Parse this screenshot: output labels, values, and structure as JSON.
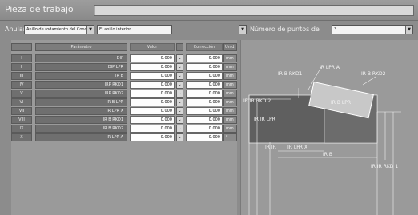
{
  "header": {
    "title": "Pieza de trabajo",
    "field_value": ""
  },
  "selectors": {
    "apply_label": "Anular",
    "ring_combo_value": "Anillo de rodamiento del Cono",
    "type_combo_value": "El anillo interior",
    "points_label": "Número de puntos de",
    "points_combo_value": "3",
    "arrow_glyph": "▼"
  },
  "table": {
    "header": {
      "index": "",
      "name": "Parámetro",
      "value": "Valor",
      "button": "",
      "correction": "Corrección",
      "unit": "Unid."
    },
    "rows": [
      {
        "index": "I",
        "name": "DIP",
        "value": "0.000",
        "button": "⌄",
        "correction": "0.000",
        "unit": "mm"
      },
      {
        "index": "II",
        "name": "DIP LPR",
        "value": "0.000",
        "button": "⌄",
        "correction": "0.000",
        "unit": "mm"
      },
      {
        "index": "III",
        "name": "IR B",
        "value": "0.000",
        "button": "⌄",
        "correction": "0.000",
        "unit": "mm"
      },
      {
        "index": "IV",
        "name": "IRP RKD1",
        "value": "0.000",
        "button": "⌄",
        "correction": "0.000",
        "unit": "mm"
      },
      {
        "index": "V",
        "name": "IRP RKD2",
        "value": "0.000",
        "button": "⌄",
        "correction": "0.000",
        "unit": "mm"
      },
      {
        "index": "VI",
        "name": "IR B LPR",
        "value": "0.000",
        "button": "⌄",
        "correction": "0.000",
        "unit": "mm"
      },
      {
        "index": "VII",
        "name": "IR LPR X",
        "value": "0.000",
        "button": "⌄",
        "correction": "0.000",
        "unit": "mm"
      },
      {
        "index": "VIII",
        "name": "IR B RKD1",
        "value": "0.000",
        "button": "⌄",
        "correction": "0.000",
        "unit": "mm"
      },
      {
        "index": "IX",
        "name": "IR B RKD2",
        "value": "0.000",
        "button": "⌄",
        "correction": "0.000",
        "unit": "mm"
      },
      {
        "index": "X",
        "name": "IR LPR A",
        "value": "0.000",
        "button": "⌄",
        "correction": "0.000",
        "unit": "º"
      }
    ]
  },
  "diagram": {
    "labels": {
      "ir_b_rkd1": "IR B RKD1",
      "ir_lpr_a": "IR LPR A",
      "ir_b_rkd2": "IR B RKD2",
      "ir_b_lpr": "IR B LPR",
      "ir_rkd2": "IR IR RKD 2",
      "ir_lpr_left": "IR IR LPR",
      "ir_lpr_x": "IR LPR X",
      "ir_lpr_small": "IR IR",
      "ir_b": "IR B",
      "ir_rkd1_right": "IR IR RKD 1"
    }
  }
}
